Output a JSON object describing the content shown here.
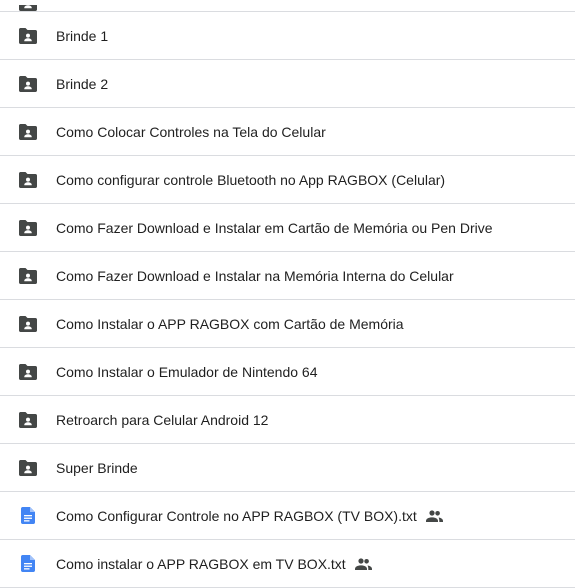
{
  "colors": {
    "folder": "#444746",
    "doc": "#4285f4",
    "divider": "#dadce0",
    "text": "#1f1f1f"
  },
  "items": [
    {
      "label": "",
      "type": "folder-shared",
      "partial": true
    },
    {
      "label": "Brinde 1",
      "type": "folder-shared",
      "icon": "shared-folder-icon"
    },
    {
      "label": "Brinde 2",
      "type": "folder-shared",
      "icon": "shared-folder-icon"
    },
    {
      "label": "Como Colocar Controles na Tela do Celular",
      "type": "folder-shared",
      "icon": "shared-folder-icon"
    },
    {
      "label": "Como configurar controle Bluetooth no App RAGBOX (Celular)",
      "type": "folder-shared",
      "icon": "shared-folder-icon"
    },
    {
      "label": "Como Fazer Download e Instalar em Cartão de Memória ou Pen Drive",
      "type": "folder-shared",
      "icon": "shared-folder-icon"
    },
    {
      "label": "Como Fazer Download e Instalar na Memória Interna do Celular",
      "type": "folder-shared",
      "icon": "shared-folder-icon"
    },
    {
      "label": "Como Instalar o APP RAGBOX com Cartão de Memória",
      "type": "folder-shared",
      "icon": "shared-folder-icon"
    },
    {
      "label": "Como Instalar o Emulador de Nintendo 64",
      "type": "folder-shared",
      "icon": "shared-folder-icon"
    },
    {
      "label": "Retroarch para Celular Android 12",
      "type": "folder-shared",
      "icon": "shared-folder-icon"
    },
    {
      "label": "Super Brinde",
      "type": "folder-shared",
      "icon": "shared-folder-icon"
    },
    {
      "label": "Como Configurar Controle no APP RAGBOX (TV BOX).txt",
      "type": "doc",
      "icon": "document-icon",
      "shared_icon": "people-icon"
    },
    {
      "label": "Como instalar o APP RAGBOX em TV BOX.txt",
      "type": "doc",
      "icon": "document-icon",
      "shared_icon": "people-icon"
    }
  ]
}
